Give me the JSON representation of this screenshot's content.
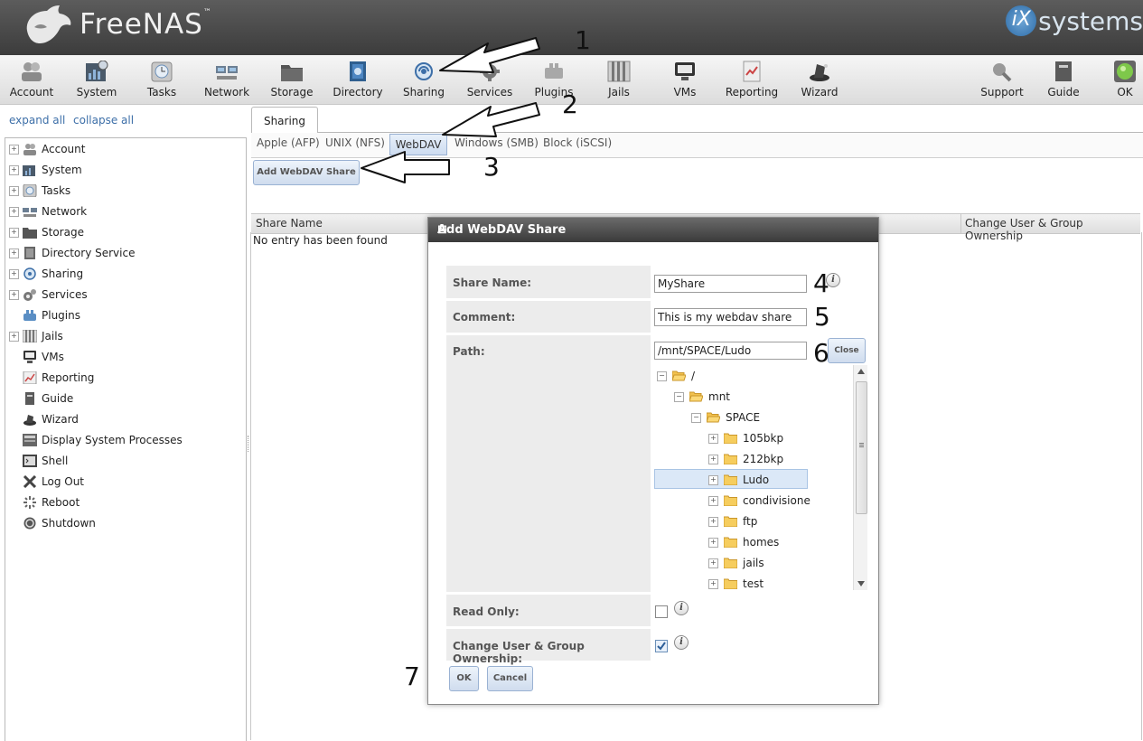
{
  "header": {
    "brand": "FreeNAS",
    "brand_tm": "™",
    "vendor_ix": "iX",
    "vendor_rest": "systems"
  },
  "toolbar": {
    "items": [
      {
        "label": "Account"
      },
      {
        "label": "System"
      },
      {
        "label": "Tasks"
      },
      {
        "label": "Network"
      },
      {
        "label": "Storage"
      },
      {
        "label": "Directory"
      },
      {
        "label": "Sharing"
      },
      {
        "label": "Services"
      },
      {
        "label": "Plugins"
      },
      {
        "label": "Jails"
      },
      {
        "label": "VMs"
      },
      {
        "label": "Reporting"
      },
      {
        "label": "Wizard"
      },
      {
        "label": "Support"
      },
      {
        "label": "Guide"
      },
      {
        "label": "OK"
      }
    ]
  },
  "sidebar": {
    "expand_all": "expand all",
    "collapse_all": "collapse all",
    "items": [
      {
        "label": "Account"
      },
      {
        "label": "System"
      },
      {
        "label": "Tasks"
      },
      {
        "label": "Network"
      },
      {
        "label": "Storage"
      },
      {
        "label": "Directory Service"
      },
      {
        "label": "Sharing"
      },
      {
        "label": "Services"
      },
      {
        "label": "Plugins"
      },
      {
        "label": "Jails"
      },
      {
        "label": "VMs"
      },
      {
        "label": "Reporting"
      },
      {
        "label": "Guide"
      },
      {
        "label": "Wizard"
      },
      {
        "label": "Display System Processes"
      },
      {
        "label": "Shell"
      },
      {
        "label": "Log Out"
      },
      {
        "label": "Reboot"
      },
      {
        "label": "Shutdown"
      }
    ]
  },
  "main": {
    "tab": "Sharing",
    "subtabs": [
      "Apple (AFP)",
      "UNIX (NFS)",
      "WebDAV",
      "Windows (SMB)",
      "Block (iSCSI)"
    ],
    "add_button": "Add WebDAV Share",
    "columns": [
      "Share Name",
      "Change User & Group Ownership"
    ],
    "empty_text": "No entry has been found"
  },
  "dialog": {
    "title": "Add WebDAV Share",
    "close_glyph": "⊠",
    "share_name_label": "Share Name:",
    "share_name_value": "MyShare",
    "comment_label": "Comment:",
    "comment_value": "This is my webdav share",
    "path_label": "Path:",
    "path_value": "/mnt/SPACE/Ludo",
    "path_close_button": "Close",
    "tree": {
      "root": "/",
      "mnt": "mnt",
      "space": "SPACE",
      "children": [
        "105bkp",
        "212bkp",
        "Ludo",
        "condivisione",
        "ftp",
        "homes",
        "jails",
        "test"
      ]
    },
    "read_only_label": "Read Only:",
    "ownership_label": "Change User & Group Ownership:",
    "ok_button": "OK",
    "cancel_button": "Cancel",
    "info_glyph": "i"
  },
  "annotations": [
    "1",
    "2",
    "3",
    "4",
    "5",
    "6",
    "7"
  ],
  "colors": {
    "accent": "#3d6fa8",
    "selected_row": "#dbe8f7",
    "header_bg": "#4a4a4a"
  }
}
